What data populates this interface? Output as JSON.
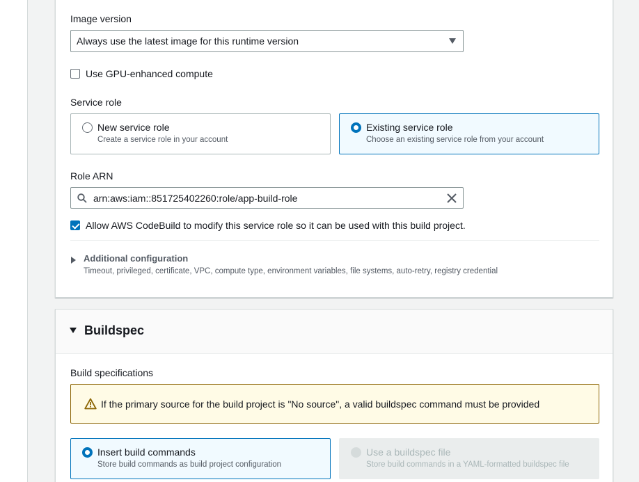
{
  "environment": {
    "image_version_label": "Image version",
    "image_version_value": "Always use the latest image for this runtime version",
    "gpu_label": "Use GPU-enhanced compute",
    "service_role_label": "Service role",
    "service_role_options": [
      {
        "title": "New service role",
        "description": "Create a service role in your account"
      },
      {
        "title": "Existing service role",
        "description": "Choose an existing service role from your account"
      }
    ],
    "role_arn_label": "Role ARN",
    "role_arn_value": "arn:aws:iam::851725402260:role/app-build-role",
    "allow_modify_label": "Allow AWS CodeBuild to modify this service role so it can be used with this build project.",
    "additional_config_title": "Additional configuration",
    "additional_config_desc": "Timeout, privileged, certificate, VPC, compute type, environment variables, file systems, auto-retry, registry credential"
  },
  "buildspec": {
    "section_title": "Buildspec",
    "build_spec_label": "Build specifications",
    "alert_text": "If the primary source for the build project is \"No source\", a valid buildspec command must be provided",
    "options": [
      {
        "title": "Insert build commands",
        "description": "Store build commands as build project configuration"
      },
      {
        "title": "Use a buildspec file",
        "description": "Store build commands in a YAML-formatted buildspec file"
      }
    ]
  },
  "colors": {
    "accent": "#0073bb",
    "warning_border": "#8d6605",
    "warning_bg": "#fffbe6"
  }
}
